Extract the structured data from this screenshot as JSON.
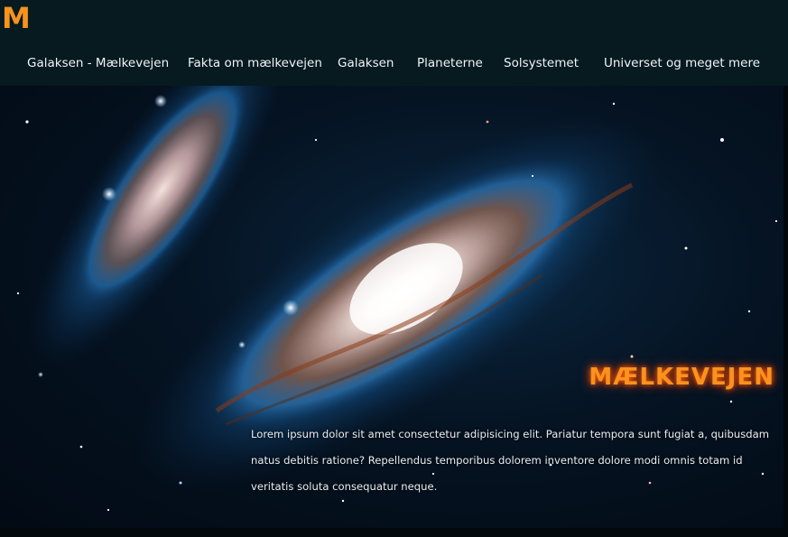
{
  "brand": {
    "logo_letter": "M",
    "accent_color": "#f7931e"
  },
  "nav": {
    "items": [
      {
        "label": "Galaksen - Mælkevejen"
      },
      {
        "label": "Fakta om mælkevejen"
      },
      {
        "label": "Galaksen"
      },
      {
        "label": "Planeterne"
      },
      {
        "label": "Solsystemet"
      },
      {
        "label": "Universet og meget mere"
      }
    ]
  },
  "hero": {
    "image": "galaxy-image",
    "title": "MÆLKEVEJEN",
    "text": "Lorem ipsum dolor sit amet consectetur adipisicing elit. Pariatur tempora sunt fugiat a, quibusdam natus debitis ratione? Repellendus temporibus dolorem inventore dolore modi omnis totam id veritatis soluta consequatur neque."
  }
}
